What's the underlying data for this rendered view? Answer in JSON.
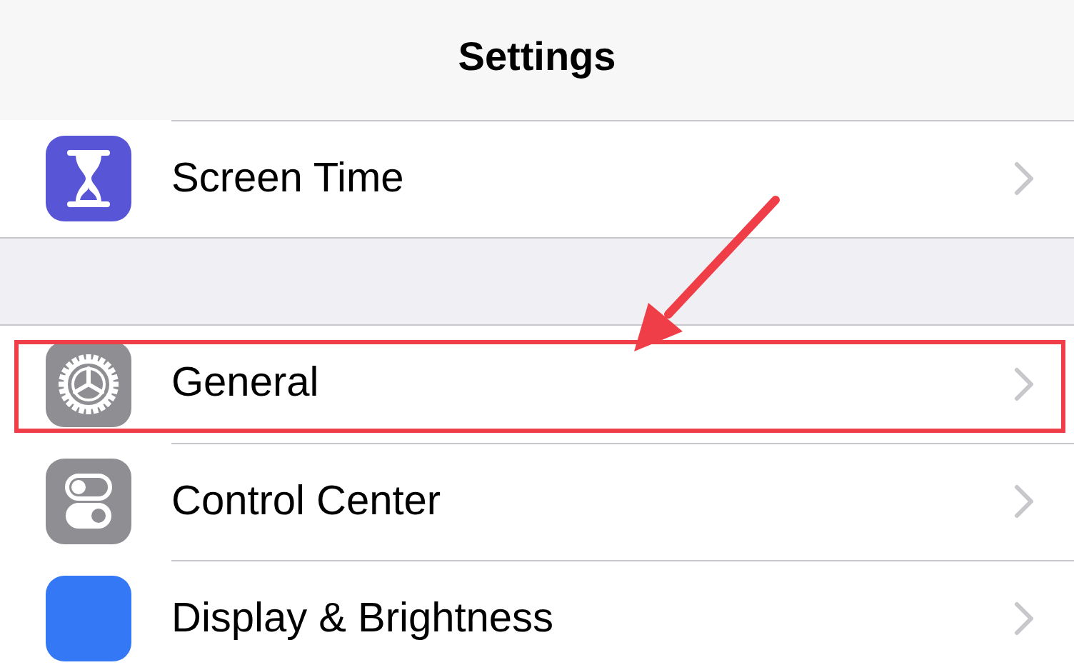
{
  "navigation_bar": {
    "title": "Settings"
  },
  "sections": [
    {
      "rows": [
        {
          "kind": "hourglass",
          "color": "#5856d6",
          "label": "Screen Time",
          "highlighted": false
        }
      ]
    },
    {
      "rows": [
        {
          "kind": "gear",
          "color": "#8e8e93",
          "label": "General",
          "highlighted": true
        },
        {
          "kind": "toggles",
          "color": "#8e8e93",
          "label": "Control Center",
          "highlighted": false
        },
        {
          "kind": "display",
          "color": "#3478f6",
          "label": "Display & Brightness",
          "highlighted": false
        }
      ]
    }
  ]
}
